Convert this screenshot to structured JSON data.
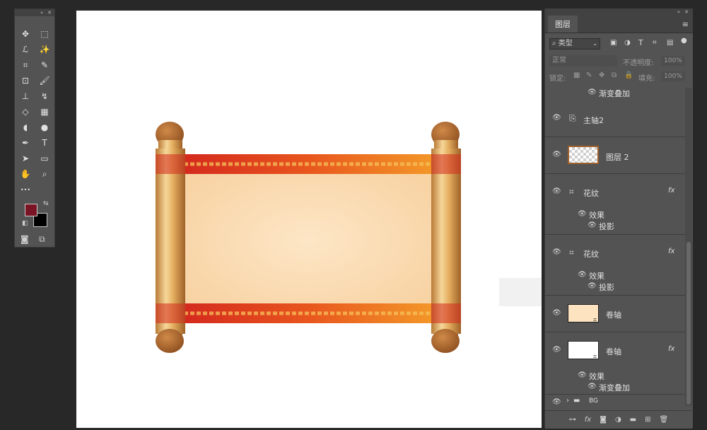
{
  "toolbar": {
    "tools": [
      {
        "icon": "move-icon",
        "glyph": "✥"
      },
      {
        "icon": "marquee-icon",
        "glyph": "⬚"
      },
      {
        "icon": "lasso-icon",
        "glyph": "ℒ"
      },
      {
        "icon": "magic-wand-icon",
        "glyph": "✨"
      },
      {
        "icon": "crop-icon",
        "glyph": "⌗"
      },
      {
        "icon": "eyedropper-icon",
        "glyph": "✎"
      },
      {
        "icon": "patch-icon",
        "glyph": "⊡"
      },
      {
        "icon": "brush-icon",
        "glyph": "🖌"
      },
      {
        "icon": "stamp-icon",
        "glyph": "⊥"
      },
      {
        "icon": "history-brush-icon",
        "glyph": "↯"
      },
      {
        "icon": "eraser-icon",
        "glyph": "◇"
      },
      {
        "icon": "gradient-icon",
        "glyph": "▦"
      },
      {
        "icon": "blur-icon",
        "glyph": "◖"
      },
      {
        "icon": "dodge-icon",
        "glyph": "●"
      },
      {
        "icon": "pen-icon",
        "glyph": "✒"
      },
      {
        "icon": "type-icon",
        "glyph": "T"
      },
      {
        "icon": "path-select-icon",
        "glyph": "➤"
      },
      {
        "icon": "rectangle-icon",
        "glyph": "▭"
      },
      {
        "icon": "hand-icon",
        "glyph": "✋"
      },
      {
        "icon": "zoom-icon",
        "glyph": "⌕"
      },
      {
        "icon": "more-tools-icon",
        "glyph": "•••"
      }
    ],
    "foreground_color": "#7a1424",
    "background_color": "#000000"
  },
  "layers_panel": {
    "tab_label": "图层",
    "filter_label": "类型",
    "blend_mode": "正常",
    "opacity_label": "不透明度:",
    "opacity_value": "100%",
    "lock_label": "锁定:",
    "fill_label": "填充:",
    "fill_value": "100%",
    "rows": {
      "r0_effect": "渐变叠加",
      "r1_name": "主轴2",
      "r2_name": "图层 2",
      "r3_name": "花纹",
      "r3_effects": "效果",
      "r3_shadow": "投影",
      "r4_name": "花纹",
      "r4_effects": "效果",
      "r4_shadow": "投影",
      "r5_name": "卷轴",
      "r6_name": "卷轴",
      "r6_effects": "效果",
      "r6_gradient": "渐变叠加",
      "r7_name": "BG"
    },
    "fx_label": "fx"
  },
  "colors": {
    "scroll_paper": "#fde3c0",
    "rod_gold": "#d9a050",
    "band_red": "#d62a1c",
    "band_orange": "#f39a2a",
    "cap_brown": "#a8622c"
  }
}
